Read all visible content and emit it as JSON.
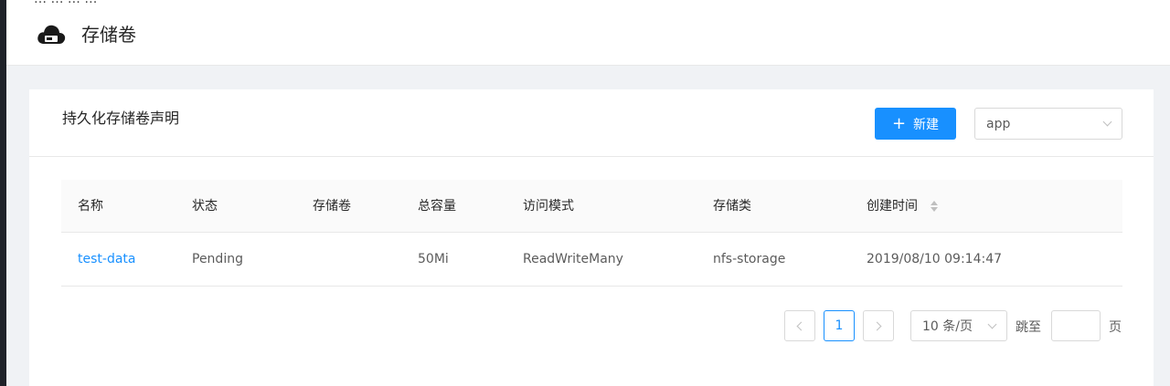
{
  "header": {
    "clipped_text": "… … … …",
    "title": "存储卷",
    "logo_icon": "cloud-storage-icon"
  },
  "card": {
    "title": "持久化存储卷声明",
    "new_button_label": "新建",
    "new_button_icon": "plus-icon",
    "namespace_select_value": "app"
  },
  "table": {
    "columns": [
      "名称",
      "状态",
      "存储卷",
      "总容量",
      "访问模式",
      "存储类",
      "创建时间"
    ],
    "rows": [
      {
        "name": "test-data",
        "status": "Pending",
        "volume": "",
        "capacity": "50Mi",
        "access_mode": "ReadWriteMany",
        "storage_class": "nfs-storage",
        "created": "2019/08/10 09:14:47"
      }
    ]
  },
  "pagination": {
    "current_page": "1",
    "page_size": "10 条/页",
    "jump_label": "跳至",
    "jump_value": "",
    "page_suffix": "页"
  },
  "colors": {
    "primary": "#1890ff",
    "background": "#f0f2f5",
    "sidebar_edge": "#1f2229"
  }
}
